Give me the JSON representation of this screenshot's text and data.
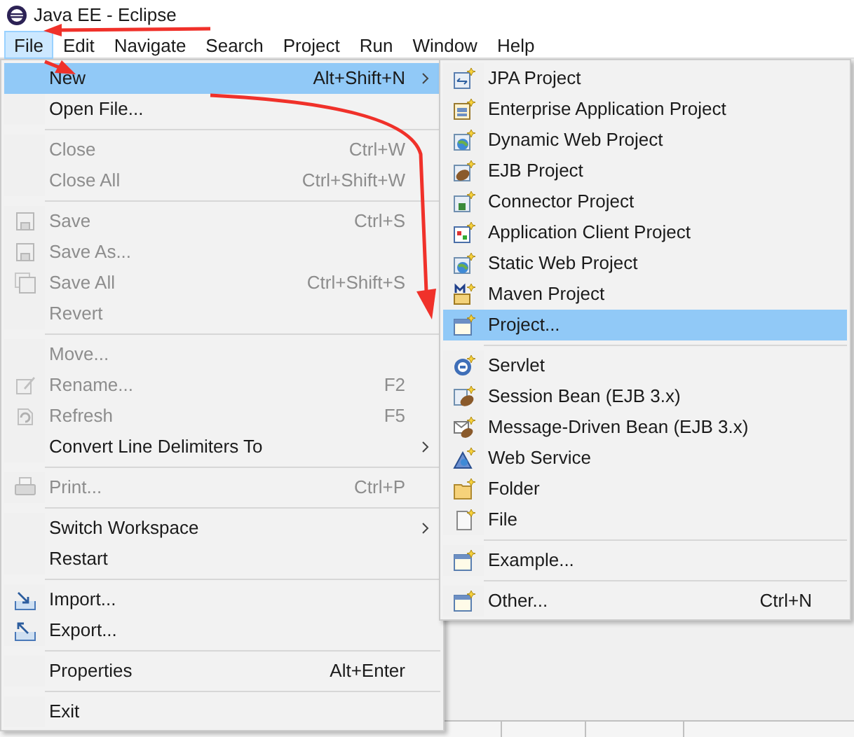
{
  "window": {
    "title": "Java EE - Eclipse"
  },
  "menu_bar": [
    {
      "label": "File",
      "selected": true
    },
    {
      "label": "Edit",
      "selected": false
    },
    {
      "label": "Navigate",
      "selected": false
    },
    {
      "label": "Search",
      "selected": false
    },
    {
      "label": "Project",
      "selected": false
    },
    {
      "label": "Run",
      "selected": false
    },
    {
      "label": "Window",
      "selected": false
    },
    {
      "label": "Help",
      "selected": false
    }
  ],
  "file_menu": [
    {
      "kind": "item",
      "label": "New",
      "shortcut": "Alt+Shift+N",
      "submenu": true,
      "disabled": false,
      "selected": true
    },
    {
      "kind": "item",
      "label": "Open File...",
      "disabled": false,
      "selected": false
    },
    {
      "kind": "separator"
    },
    {
      "kind": "item",
      "label": "Close",
      "shortcut": "Ctrl+W",
      "disabled": true,
      "selected": false
    },
    {
      "kind": "item",
      "label": "Close All",
      "shortcut": "Ctrl+Shift+W",
      "disabled": true,
      "selected": false
    },
    {
      "kind": "separator"
    },
    {
      "kind": "item",
      "label": "Save",
      "shortcut": "Ctrl+S",
      "disabled": true,
      "selected": false
    },
    {
      "kind": "item",
      "label": "Save As...",
      "disabled": true,
      "selected": false
    },
    {
      "kind": "item",
      "label": "Save All",
      "shortcut": "Ctrl+Shift+S",
      "disabled": true,
      "selected": false
    },
    {
      "kind": "item",
      "label": "Revert",
      "disabled": true,
      "selected": false
    },
    {
      "kind": "separator"
    },
    {
      "kind": "item",
      "label": "Move...",
      "disabled": true,
      "selected": false
    },
    {
      "kind": "item",
      "label": "Rename...",
      "shortcut": "F2",
      "disabled": true,
      "selected": false
    },
    {
      "kind": "item",
      "label": "Refresh",
      "shortcut": "F5",
      "disabled": true,
      "selected": false
    },
    {
      "kind": "item",
      "label": "Convert Line Delimiters To",
      "submenu": true,
      "disabled": false,
      "selected": false
    },
    {
      "kind": "separator"
    },
    {
      "kind": "item",
      "label": "Print...",
      "shortcut": "Ctrl+P",
      "disabled": true,
      "selected": false
    },
    {
      "kind": "separator"
    },
    {
      "kind": "item",
      "label": "Switch Workspace",
      "submenu": true,
      "disabled": false,
      "selected": false
    },
    {
      "kind": "item",
      "label": "Restart",
      "disabled": false,
      "selected": false
    },
    {
      "kind": "separator"
    },
    {
      "kind": "item",
      "label": "Import...",
      "disabled": false,
      "selected": false
    },
    {
      "kind": "item",
      "label": "Export...",
      "disabled": false,
      "selected": false
    },
    {
      "kind": "separator"
    },
    {
      "kind": "item",
      "label": "Properties",
      "shortcut": "Alt+Enter",
      "disabled": false,
      "selected": false
    },
    {
      "kind": "separator"
    },
    {
      "kind": "item",
      "label": "Exit",
      "disabled": false,
      "selected": false
    }
  ],
  "new_submenu": [
    {
      "kind": "item",
      "label": "JPA Project",
      "selected": false
    },
    {
      "kind": "item",
      "label": "Enterprise Application Project",
      "selected": false
    },
    {
      "kind": "item",
      "label": "Dynamic Web Project",
      "selected": false
    },
    {
      "kind": "item",
      "label": "EJB Project",
      "selected": false
    },
    {
      "kind": "item",
      "label": "Connector Project",
      "selected": false
    },
    {
      "kind": "item",
      "label": "Application Client Project",
      "selected": false
    },
    {
      "kind": "item",
      "label": "Static Web Project",
      "selected": false
    },
    {
      "kind": "item",
      "label": "Maven Project",
      "selected": false
    },
    {
      "kind": "item",
      "label": "Project...",
      "selected": true
    },
    {
      "kind": "separator"
    },
    {
      "kind": "item",
      "label": "Servlet",
      "selected": false
    },
    {
      "kind": "item",
      "label": "Session Bean (EJB 3.x)",
      "selected": false
    },
    {
      "kind": "item",
      "label": "Message-Driven Bean (EJB 3.x)",
      "selected": false
    },
    {
      "kind": "item",
      "label": "Web Service",
      "selected": false
    },
    {
      "kind": "item",
      "label": "Folder",
      "selected": false
    },
    {
      "kind": "item",
      "label": "File",
      "selected": false
    },
    {
      "kind": "separator"
    },
    {
      "kind": "item",
      "label": "Example...",
      "selected": false
    },
    {
      "kind": "separator"
    },
    {
      "kind": "item",
      "label": "Other...",
      "shortcut": "Ctrl+N",
      "selected": false
    }
  ]
}
